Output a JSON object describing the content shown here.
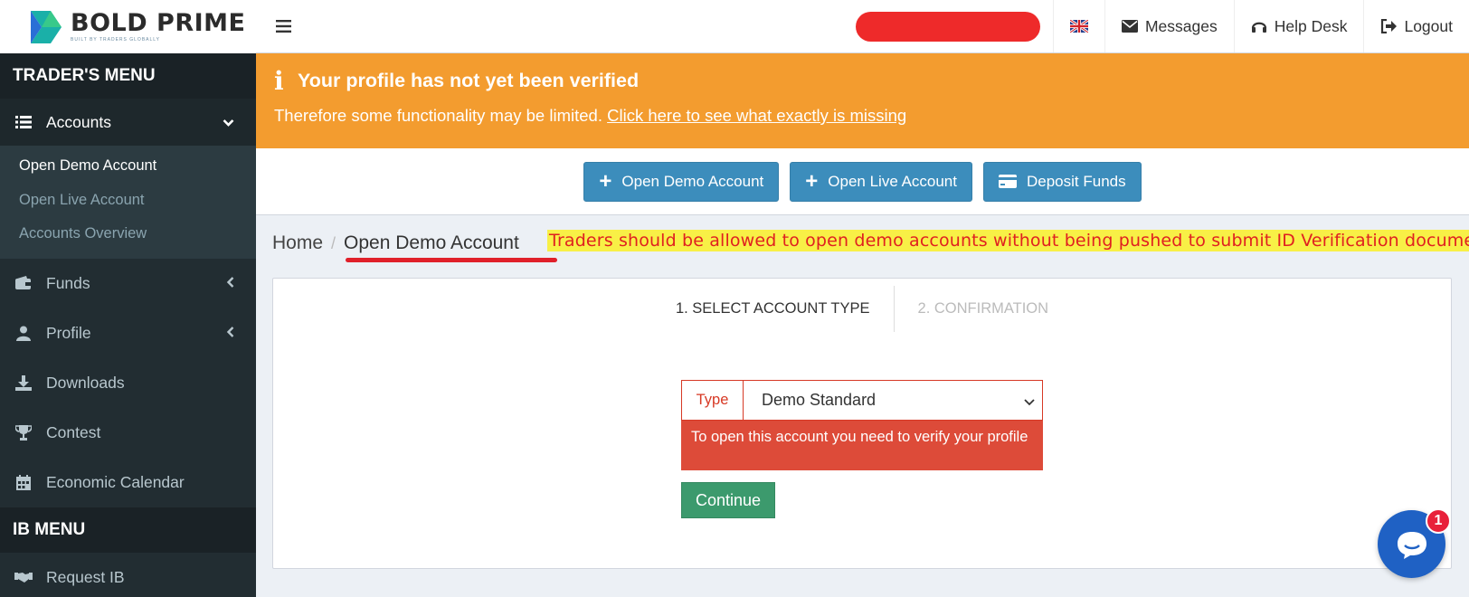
{
  "brand": {
    "name": "BOLD PRIME",
    "tagline": "BUILT BY TRADERS GLOBALLY"
  },
  "sidebar": {
    "traders_menu_title": "TRADER'S MENU",
    "accounts": {
      "label": "Accounts",
      "icon": "list-icon",
      "submenu": [
        "Open Demo Account",
        "Open Live Account",
        "Accounts Overview"
      ]
    },
    "items": [
      {
        "label": "Funds",
        "icon": "wallet-icon"
      },
      {
        "label": "Profile",
        "icon": "user-icon"
      },
      {
        "label": "Downloads",
        "icon": "download-icon"
      },
      {
        "label": "Contest",
        "icon": "trophy-icon"
      },
      {
        "label": "Economic Calendar",
        "icon": "calendar-icon"
      }
    ],
    "ib_menu_title": "IB MENU",
    "ib_items": [
      {
        "label": "Request IB",
        "icon": "handshake-icon"
      }
    ]
  },
  "topbar": {
    "messages": "Messages",
    "help_desk": "Help Desk",
    "logout": "Logout"
  },
  "alert": {
    "title": "Your profile has not yet been verified",
    "body": "Therefore some functionality may be limited.",
    "link": "Click here to see what exactly is missing"
  },
  "actions": {
    "open_demo": "Open Demo Account",
    "open_live": "Open Live Account",
    "deposit": "Deposit Funds"
  },
  "breadcrumb": {
    "home": "Home",
    "separator": "/",
    "current": "Open Demo Account"
  },
  "annotation": "Traders should be allowed to open demo accounts without being pushed to submit ID Verification documents.",
  "wizard": {
    "step1": "1. SELECT ACCOUNT TYPE",
    "step2": "2. CONFIRMATION",
    "type_label": "Type",
    "type_value": "Demo Standard",
    "error": "To open this account you need to verify your profile",
    "continue": "Continue"
  },
  "chat": {
    "badge": "1"
  },
  "colors": {
    "sidebar": "#222d32",
    "alert": "#f39c2f",
    "primary": "#3c8dbc",
    "success": "#3c9a6d",
    "danger": "#dd4b39"
  }
}
